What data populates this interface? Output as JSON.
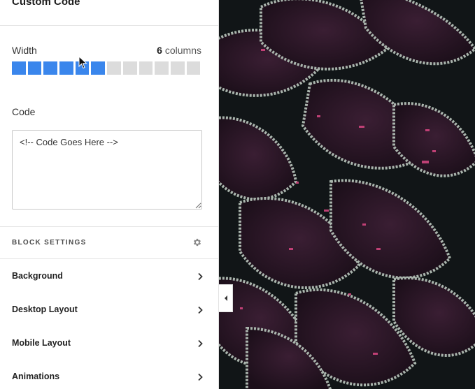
{
  "panel": {
    "title": "Custom Code",
    "width": {
      "label": "Width",
      "value_number": "6",
      "value_unit": "columns",
      "selected_columns": 6,
      "total_columns": 12
    },
    "code": {
      "label": "Code",
      "value": "<!-- Code Goes Here -->"
    },
    "block_settings": {
      "heading": "BLOCK SETTINGS",
      "items": [
        {
          "label": "Background"
        },
        {
          "label": "Desktop Layout"
        },
        {
          "label": "Mobile Layout"
        },
        {
          "label": "Animations"
        }
      ]
    }
  },
  "colors": {
    "accent": "#3a86ec",
    "inactive": "#dcdcdc",
    "leaf_dark": "#2a1725",
    "leaf_edge": "#a7b2aa",
    "leaf_pink": "#d0457e"
  },
  "icons": [
    "gear-icon",
    "chevron-right-icon",
    "collapse-left-icon",
    "mouse-cursor-icon",
    "resize-grip-icon"
  ]
}
